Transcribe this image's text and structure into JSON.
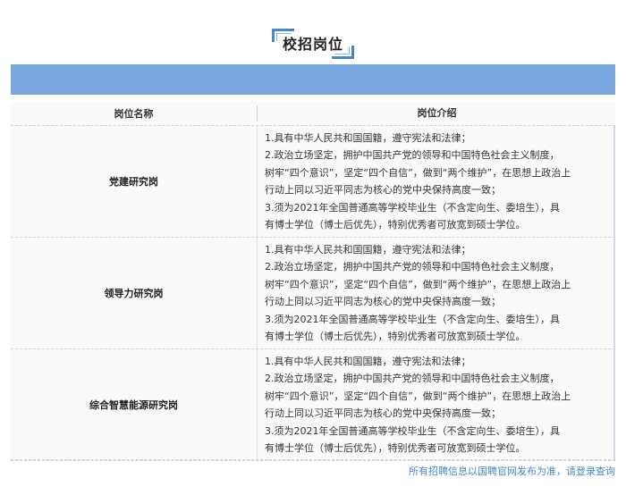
{
  "section_title": "校招岗位",
  "table": {
    "headers": {
      "name": "岗位名称",
      "description": "岗位介绍"
    },
    "rows": [
      {
        "name": "党建研究岗",
        "lines": [
          "1.具有中华人民共和国国籍，遵守宪法和法律；",
          "2.政治立场坚定，拥护中国共产党的领导和中国特色社会主义制度，",
          "树牢“四个意识”，坚定“四个自信”，做到“两个维护”，在思想上政治上",
          "行动上同以习近平同志为核心的党中央保持高度一致；",
          "3.须为2021年全国普通高等学校毕业生（不含定向生、委培生），具",
          "有博士学位（博士后优先），特别优秀者可放宽到硕士学位。"
        ]
      },
      {
        "name": "领导力研究岗",
        "lines": [
          "1.具有中华人民共和国国籍，遵守宪法和法律；",
          "2.政治立场坚定，拥护中国共产党的领导和中国特色社会主义制度，",
          "树牢“四个意识”，坚定“四个自信”，做到“两个维护”，在思想上政治上",
          "行动上同以习近平同志为核心的党中央保持高度一致；",
          "3.须为2021年全国普通高等学校毕业生（不含定向生、委培生），具",
          "有博士学位（博士后优先），特别优秀者可放宽到硕士学位。"
        ]
      },
      {
        "name": "综合智慧能源研究岗",
        "lines": [
          "1.具有中华人民共和国国籍，遵守宪法和法律；",
          "2.政治立场坚定，拥护中国共产党的领导和中国特色社会主义制度，",
          "树牢“四个意识”，坚定“四个自信”，做到“两个维护”，在思想上政治上",
          "行动上同以习近平同志为核心的党中央保持高度一致；",
          "3.须为2021年全国普通高等学校毕业生（不含定向生、委培生），具",
          "有博士学位（博士后优先），特别优秀者可放宽到硕士学位。"
        ]
      }
    ]
  },
  "footer_note": "所有招聘信息以国聘官网发布为准，请登录查询",
  "colors": {
    "accent": "#4a86c8",
    "banner": "#7aa7de"
  }
}
